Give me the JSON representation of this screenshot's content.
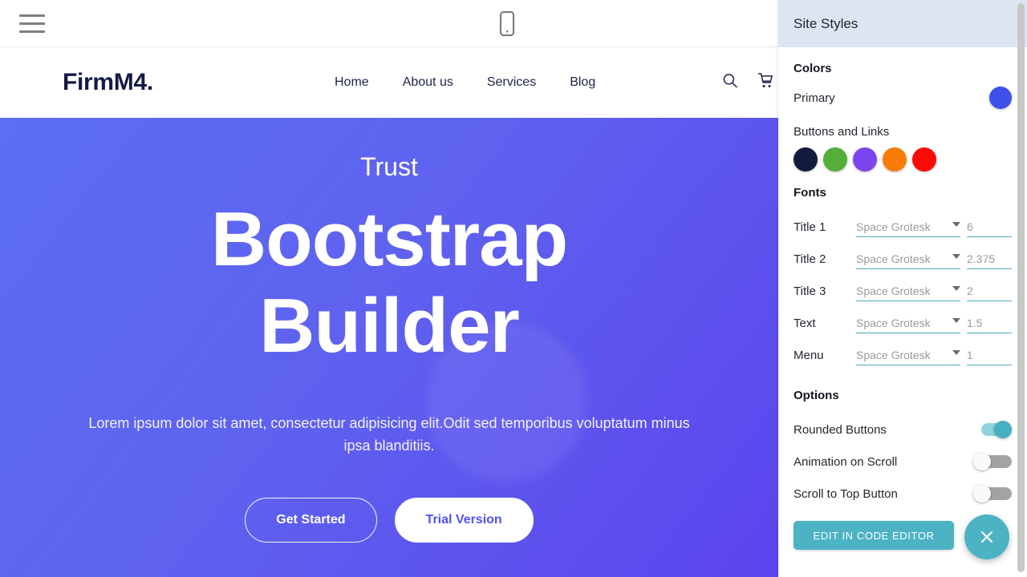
{
  "builder": {
    "toolbar": {
      "menu_icon": "hamburger-menu-icon",
      "device_icon": "mobile-device-preview-icon"
    },
    "panel": {
      "title": "Site Styles",
      "colors": {
        "heading": "Colors",
        "primary_label": "Primary",
        "primary_color": "#3d50ea",
        "buttons_links_label": "Buttons and Links",
        "buttons_links_colors": [
          "#121b3c",
          "#55ad3a",
          "#7b45ef",
          "#f97c06",
          "#fc0b04"
        ]
      },
      "fonts": {
        "heading": "Fonts",
        "rows": [
          {
            "label": "Title 1",
            "font": "Space Grotesk",
            "size": "6"
          },
          {
            "label": "Title 2",
            "font": "Space Grotesk",
            "size": "2.375"
          },
          {
            "label": "Title 3",
            "font": "Space Grotesk",
            "size": "2"
          },
          {
            "label": "Text",
            "font": "Space Grotesk",
            "size": "1.5"
          },
          {
            "label": "Menu",
            "font": "Space Grotesk",
            "size": "1"
          }
        ]
      },
      "options": {
        "heading": "Options",
        "rows": [
          {
            "label": "Rounded Buttons",
            "state": "on"
          },
          {
            "label": "Animation on Scroll",
            "state": "off"
          },
          {
            "label": "Scroll to Top Button",
            "state": "off"
          }
        ],
        "code_editor_button": "EDIT IN CODE EDITOR"
      },
      "close_icon": "close-x-icon",
      "accent_color": "#4cb3c4"
    }
  },
  "site": {
    "logo": "FirmM4.",
    "nav": [
      {
        "label": "Home"
      },
      {
        "label": "About us"
      },
      {
        "label": "Services"
      },
      {
        "label": "Blog"
      }
    ],
    "header_icons": [
      "search-icon",
      "cart-icon"
    ],
    "hero": {
      "kicker": "Trust",
      "title_line1": "Bootstrap",
      "title_line2": "Builder",
      "subtitle": "Lorem ipsum dolor sit amet, consectetur adipisicing elit.Odit sed temporibus voluptatum minus ipsa blanditiis.",
      "primary_button": "Get Started",
      "secondary_button": "Trial Version"
    }
  }
}
